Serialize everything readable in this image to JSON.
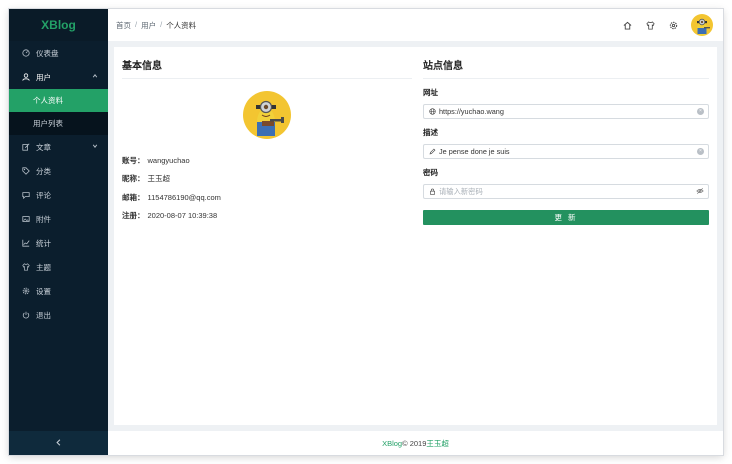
{
  "app": {
    "brand": "XBlog"
  },
  "sidebar": {
    "items": [
      {
        "label": "仪表盘",
        "icon": "dashboard-icon"
      },
      {
        "label": "用户",
        "icon": "user-icon",
        "open": true,
        "children": [
          {
            "label": "个人资料",
            "active": true
          },
          {
            "label": "用户列表"
          }
        ]
      },
      {
        "label": "文章",
        "icon": "edit-icon",
        "has_children": true
      },
      {
        "label": "分类",
        "icon": "tag-icon"
      },
      {
        "label": "评论",
        "icon": "comment-icon"
      },
      {
        "label": "附件",
        "icon": "image-icon"
      },
      {
        "label": "统计",
        "icon": "chart-icon"
      },
      {
        "label": "主题",
        "icon": "shirt-icon"
      },
      {
        "label": "设置",
        "icon": "gear-icon"
      },
      {
        "label": "退出",
        "icon": "power-icon"
      }
    ],
    "collapse_icon": "chevron-left-icon"
  },
  "header": {
    "breadcrumb": [
      "首页",
      "用户",
      "个人资料"
    ],
    "separator": "/",
    "icons": [
      "home-icon",
      "shirt-icon",
      "gear-icon",
      "avatar"
    ]
  },
  "profile": {
    "title": "基本信息",
    "rows": [
      {
        "label": "账号：",
        "value": "wangyuchao"
      },
      {
        "label": "昵称：",
        "value": "王玉超"
      },
      {
        "label": "邮箱：",
        "value": "1154786190@qq.com"
      },
      {
        "label": "注册：",
        "value": "2020-08-07 10:39:38"
      }
    ]
  },
  "site": {
    "title": "站点信息",
    "url_label": "网址",
    "url_value": "https://yuchao.wang",
    "desc_label": "描述",
    "desc_value": "Je pense done je suis",
    "pwd_label": "密码",
    "pwd_placeholder": "请输入新密码",
    "submit_label": "更 新"
  },
  "footer": {
    "brand": "XBlog",
    "copyright": " © 2019",
    "author": "王玉超"
  },
  "colors": {
    "accent": "#23a167",
    "sidebar_bg": "#0b1e2d",
    "button": "#23915f"
  }
}
